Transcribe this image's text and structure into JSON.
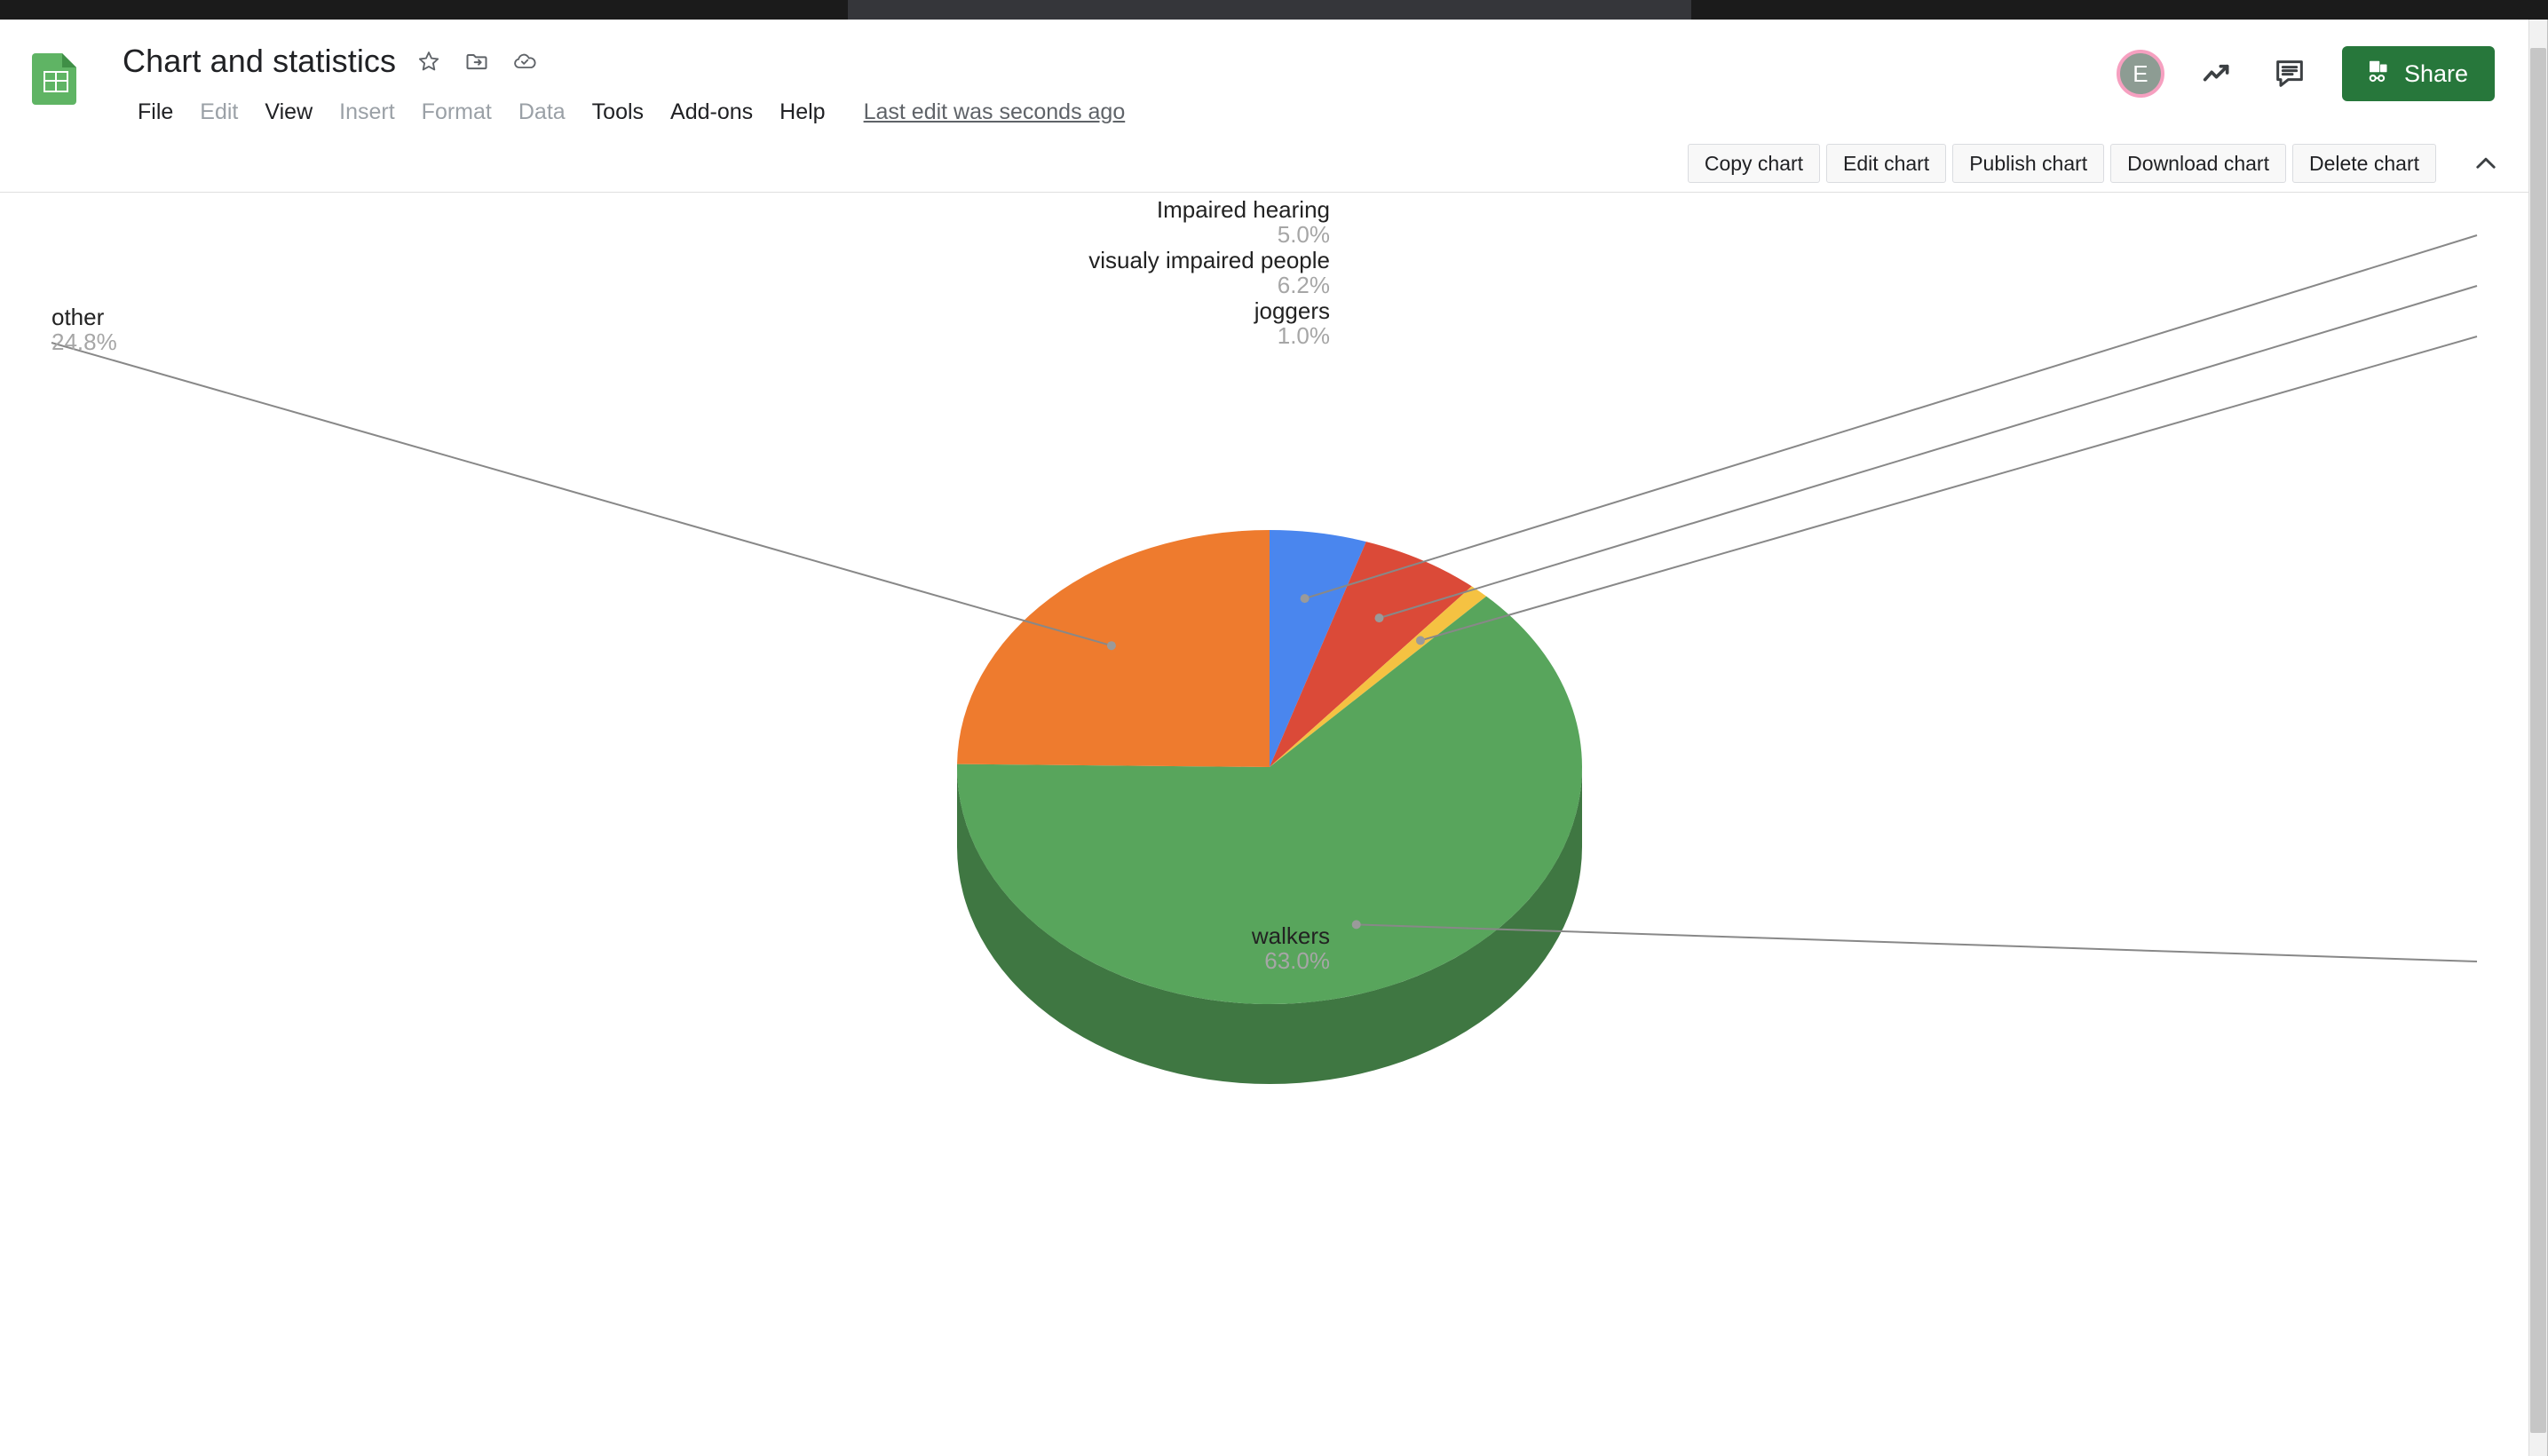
{
  "browser": {
    "chrome_bar": "browser-chrome-bar",
    "active_tab": "active-tab-region"
  },
  "header": {
    "app_icon": "google-sheets-icon",
    "doc_title": "Chart and statistics",
    "star_icon": "star-icon",
    "move_icon": "move-to-folder-icon",
    "cloud_icon": "cloud-saved-icon",
    "menus": [
      {
        "label": "File",
        "disabled": false
      },
      {
        "label": "Edit",
        "disabled": true
      },
      {
        "label": "View",
        "disabled": false
      },
      {
        "label": "Insert",
        "disabled": true
      },
      {
        "label": "Format",
        "disabled": true
      },
      {
        "label": "Data",
        "disabled": true
      },
      {
        "label": "Tools",
        "disabled": false
      },
      {
        "label": "Add-ons",
        "disabled": false
      },
      {
        "label": "Help",
        "disabled": false
      }
    ],
    "last_edit": "Last edit was seconds ago",
    "avatar_initial": "E",
    "avatar_ring_color": "#f6a0c0",
    "trending_icon": "trending-up-icon",
    "comment_icon": "comment-icon",
    "share_label": "Share",
    "share_icon": "share-lock-icon",
    "share_color": "#27773b"
  },
  "chart_toolbar": {
    "buttons": [
      "Copy chart",
      "Edit chart",
      "Publish chart",
      "Download chart",
      "Delete chart"
    ],
    "collapse_icon": "chevron-up-icon"
  },
  "chart_data": {
    "type": "pie",
    "title": "",
    "three_d": true,
    "legend": "none",
    "label_format": "label-and-percentage",
    "categories": [
      "Impaired hearing",
      "visualy impaired people",
      "joggers",
      "walkers",
      "other"
    ],
    "values": [
      5.0,
      6.2,
      1.0,
      63.0,
      24.8
    ],
    "value_labels": [
      "5.0%",
      "6.2%",
      "1.0%",
      "63.0%",
      "24.8%"
    ],
    "colors": [
      "#4a86ee",
      "#db4a38",
      "#f5c242",
      "#58a55c",
      "#ee7b2e"
    ],
    "side_colors": [
      "#33589e",
      "#933025",
      "#a98126",
      "#3f7638",
      "#a1521d"
    ],
    "slices": [
      {
        "label": "Impaired hearing",
        "percent": 5.0,
        "value_label": "5.0%",
        "color": "#4a86ee"
      },
      {
        "label": "visualy impaired people",
        "percent": 6.2,
        "value_label": "6.2%",
        "color": "#db4a38"
      },
      {
        "label": "joggers",
        "percent": 1.0,
        "value_label": "1.0%",
        "color": "#f5c242"
      },
      {
        "label": "walkers",
        "percent": 63.0,
        "value_label": "63.0%",
        "color": "#58a55c"
      },
      {
        "label": "other",
        "percent": 24.8,
        "value_label": "24.8%",
        "color": "#ee7b2e"
      }
    ]
  },
  "scrollbar": {
    "track": "vertical-scrollbar-track",
    "thumb": "vertical-scrollbar-thumb"
  }
}
